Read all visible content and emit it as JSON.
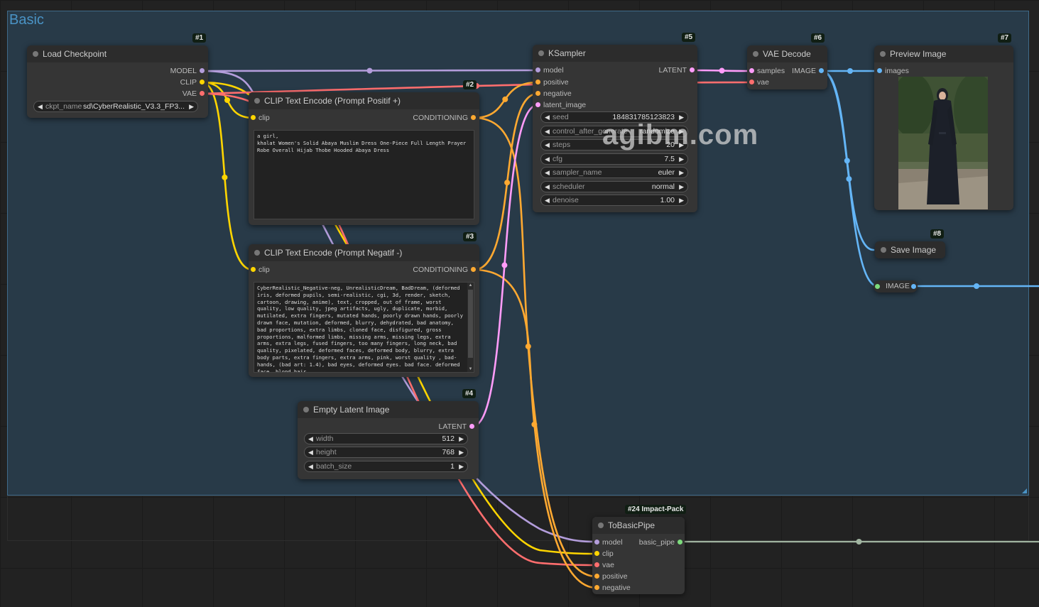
{
  "group": {
    "title": "Basic"
  },
  "colors": {
    "model": "#b39ddb",
    "clip": "#ffd500",
    "vae": "#ff6e6e",
    "conditioning": "#ffa931",
    "latent": "#ff9cf9",
    "image": "#64b5f6",
    "basic_pipe": "#a0b4a0",
    "int": "#7ddb7d"
  },
  "nodes": {
    "load_checkpoint": {
      "id": "#1",
      "title": "Load Checkpoint",
      "outputs": [
        "MODEL",
        "CLIP",
        "VAE"
      ],
      "widget": {
        "name": "ckpt_name",
        "value": "sd\\CyberRealistic_V3.3_FP3..."
      }
    },
    "clip_pos": {
      "id": "#2",
      "title": "CLIP Text Encode (Prompt Positif +)",
      "input": "clip",
      "output": "CONDITIONING",
      "text": "a girl,\nkhalat Women's Solid Abaya Muslim Dress One-Piece Full Length Prayer Robe Overall Hijab Thobe Hooded Abaya Dress"
    },
    "clip_neg": {
      "id": "#3",
      "title": "CLIP Text Encode (Prompt Negatif -)",
      "input": "clip",
      "output": "CONDITIONING",
      "text": "CyberRealistic_Negative-neg, UnrealisticDream, BadDream, (deformed iris, deformed pupils, semi-realistic, cgi, 3d, render, sketch, cartoon, drawing, anime), text, cropped, out of frame, worst quality, low quality, jpeg artifacts, ugly, duplicate, morbid, mutilated, extra fingers, mutated hands, poorly drawn hands, poorly drawn face, mutation, deformed, blurry, dehydrated, bad anatomy, bad proportions, extra limbs, cloned face, disfigured, gross proportions, malformed limbs, missing arms, missing legs, extra arms, extra legs, fused fingers, too many fingers, long neck, bad quality, pixelated, deformed faces, deformed body, blurry, extra body parts, extra fingers, extra arms, pink, worst quality , bad-hands, (bad art: 1.4), bad eyes, deformed eyes. bad face. deformed face. blond hair"
    },
    "empty_latent": {
      "id": "#4",
      "title": "Empty Latent Image",
      "output": "LATENT",
      "widgets": [
        {
          "name": "width",
          "value": "512"
        },
        {
          "name": "height",
          "value": "768"
        },
        {
          "name": "batch_size",
          "value": "1"
        }
      ]
    },
    "ksampler": {
      "id": "#5",
      "title": "KSampler",
      "inputs": [
        "model",
        "positive",
        "negative",
        "latent_image"
      ],
      "output": "LATENT",
      "widgets": [
        {
          "name": "seed",
          "value": "184831785123823"
        },
        {
          "name": "control_after_generate",
          "value": "randomize"
        },
        {
          "name": "steps",
          "value": "20"
        },
        {
          "name": "cfg",
          "value": "7.5"
        },
        {
          "name": "sampler_name",
          "value": "euler"
        },
        {
          "name": "scheduler",
          "value": "normal"
        },
        {
          "name": "denoise",
          "value": "1.00"
        }
      ]
    },
    "vae_decode": {
      "id": "#6",
      "title": "VAE Decode",
      "inputs": [
        "samples",
        "vae"
      ],
      "output": "IMAGE"
    },
    "preview_image": {
      "id": "#7",
      "title": "Preview Image",
      "input": "images"
    },
    "save_image": {
      "id": "#8",
      "title": "Save Image"
    },
    "image_reroute": {
      "label": "IMAGE"
    },
    "to_basic_pipe": {
      "id": "#24 Impact-Pack",
      "title": "ToBasicPipe",
      "inputs": [
        "model",
        "clip",
        "vae",
        "positive",
        "negative"
      ],
      "output": "basic_pipe"
    }
  },
  "watermark": "agibm.com"
}
